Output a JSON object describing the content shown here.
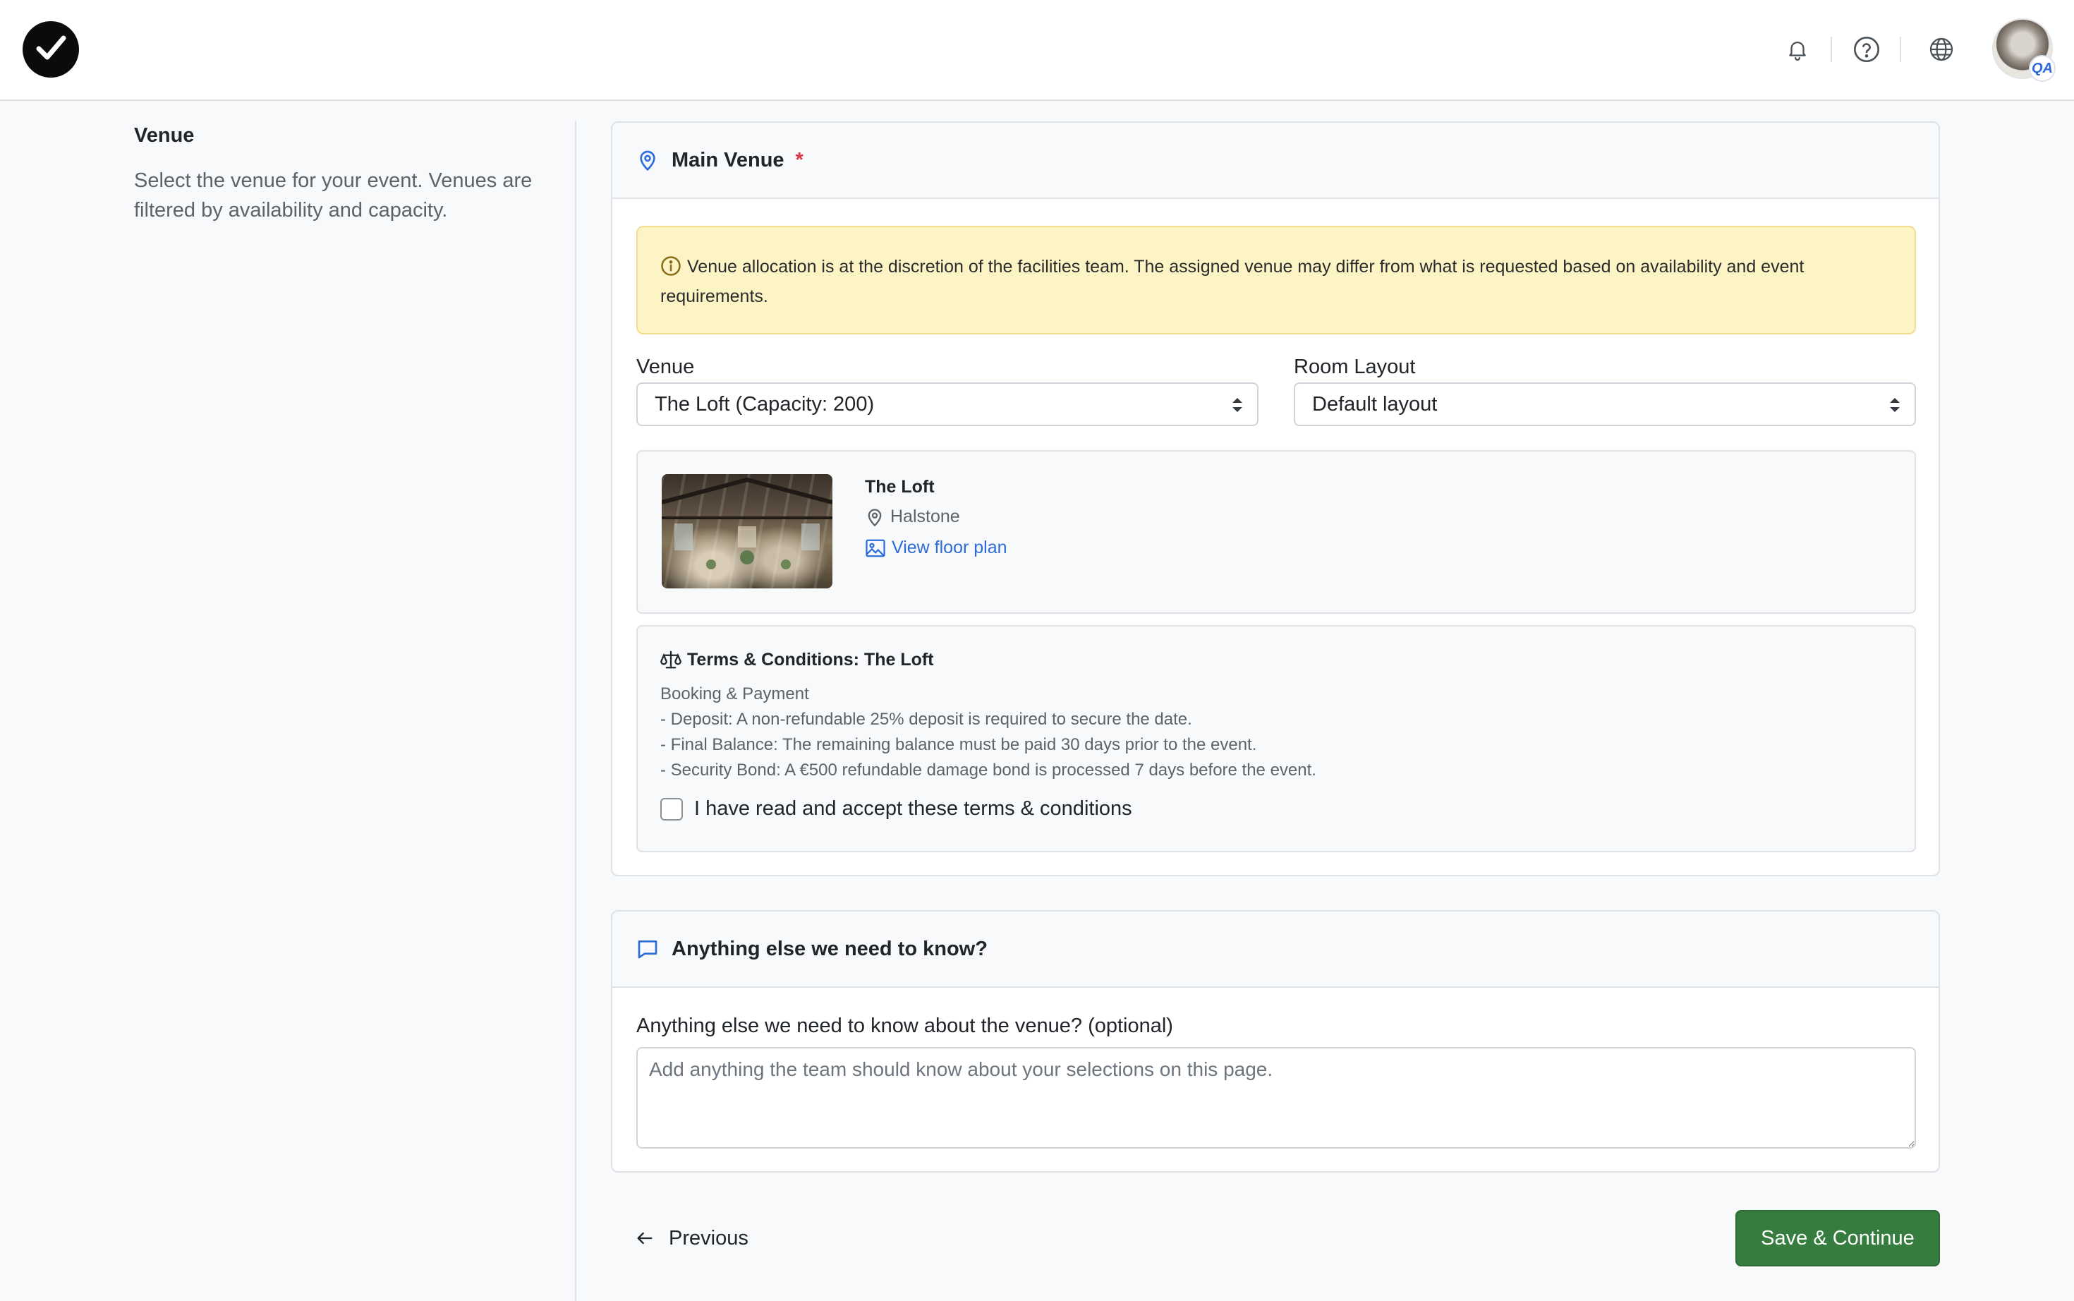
{
  "topbar": {
    "icons": [
      "notifications-icon",
      "help-icon",
      "language-globe-icon"
    ],
    "avatar_badge": "QA"
  },
  "sidebar": {
    "title": "Venue",
    "description": "Select the venue for your event. Venues are filtered by availability and capacity."
  },
  "main_venue": {
    "title": "Main Venue",
    "required_marker": "*",
    "notice": "Venue allocation is at the discretion of the facilities team. The assigned venue may differ from what is requested based on availability and event requirements.",
    "venue_label": "Venue",
    "venue_value": "The Loft (Capacity: 200)",
    "layout_label": "Room Layout",
    "layout_value": "Default layout",
    "venue_card": {
      "name": "The Loft",
      "location": "Halstone",
      "floor_plan_link": "View floor plan"
    },
    "terms": {
      "title": "Terms & Conditions: The Loft",
      "heading": "Booking & Payment",
      "lines": [
        "- Deposit: A non-refundable 25% deposit is required to secure the date.",
        "- Final Balance: The remaining balance must be paid 30 days prior to the event.",
        "- Security Bond: A €500 refundable damage bond is processed 7 days before the event."
      ],
      "accept_label": "I have read and accept these terms & conditions",
      "accepted": false
    }
  },
  "notes": {
    "title": "Anything else we need to know?",
    "field_label": "Anything else we need to know about the venue? (optional)",
    "placeholder": "Add anything the team should know about your selections on this page."
  },
  "footer": {
    "previous_label": "Previous",
    "save_label": "Save & Continue"
  },
  "colors": {
    "primary_blue": "#2c6bd9",
    "success_green": "#367c3f",
    "warning_bg": "#fdf4c6",
    "required_red": "#dc3545"
  }
}
